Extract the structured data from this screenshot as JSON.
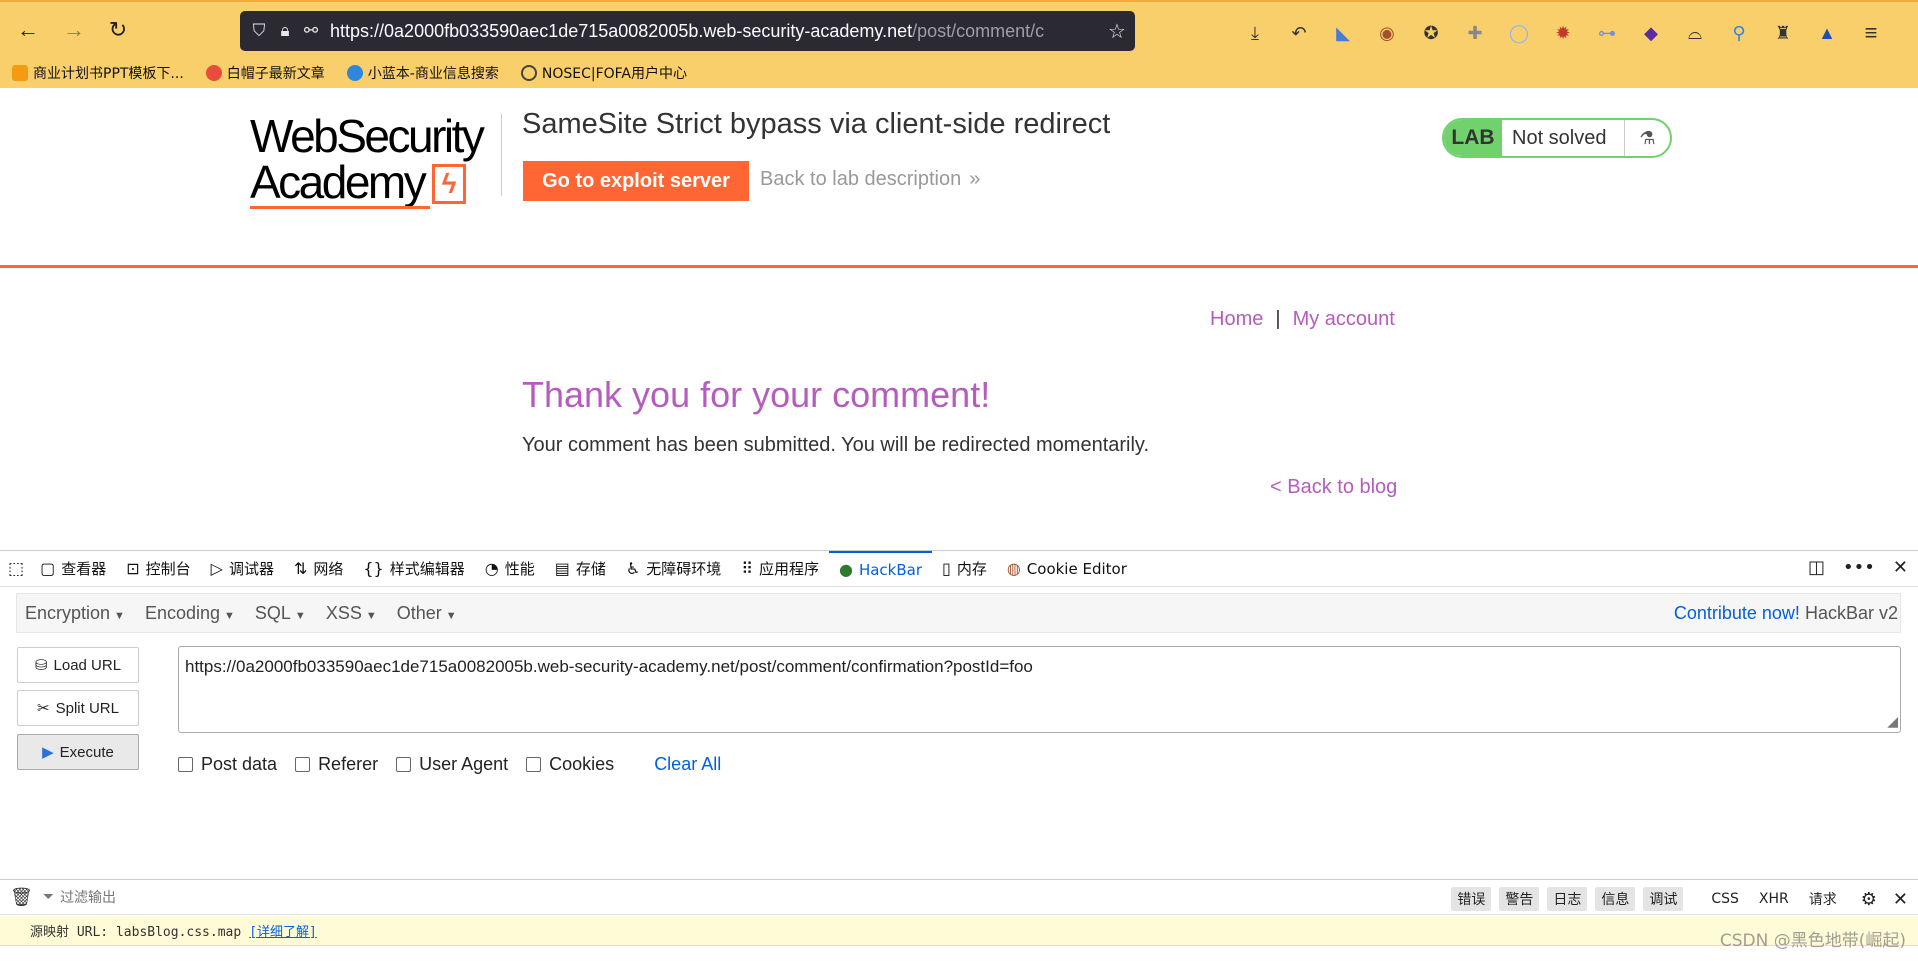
{
  "browser": {
    "url_scheme": "https://",
    "url_host": "0a2000fb033590aec1de715a0082005b.web-security-academy.net",
    "url_path": "/post/comment/c",
    "extensions": [
      "download-icon",
      "undo-icon",
      "ext-bird-icon",
      "ext-cookie-icon",
      "ext-cookie2-icon",
      "ext-puzzle-icon",
      "ext-circle-icon",
      "ext-sun-icon",
      "ext-toggle-icon",
      "ext-diamond-icon",
      "ext-hat-icon",
      "ext-pin-icon",
      "ext-spy-icon",
      "ext-triangle-icon",
      "menu-icon"
    ],
    "bookmarks": [
      {
        "label": "商业计划书PPT模板下...",
        "color": "#f39c12"
      },
      {
        "label": "白帽子最新文章",
        "color": "#e74c3c"
      },
      {
        "label": "小蓝本-商业信息搜索",
        "color": "#2e86de"
      },
      {
        "label": "NOSEC|FOFA用户中心",
        "color": "#444444"
      }
    ]
  },
  "lab": {
    "logo_line1": "WebSecurity",
    "logo_line2": "Academy",
    "logo_bolt": "ϟ",
    "title": "SameSite Strict bypass via client-side redirect",
    "exploit_button": "Go to exploit server",
    "back_description": "Back to lab description",
    "back_chevron": "»",
    "status_badge": "LAB",
    "status_text": "Not solved",
    "nav_home": "Home",
    "nav_separator": "|",
    "nav_account": "My account",
    "confirmation_title": "Thank you for your comment!",
    "confirmation_text": "Your comment has been submitted. You will be redirected momentarily.",
    "back_to_blog": "< Back to blog"
  },
  "devtools": {
    "tabs": [
      {
        "label": "查看器",
        "icon": "▢"
      },
      {
        "label": "控制台",
        "icon": "⊡"
      },
      {
        "label": "调试器",
        "icon": "▷"
      },
      {
        "label": "网络",
        "icon": "⇅"
      },
      {
        "label": "样式编辑器",
        "icon": "{}"
      },
      {
        "label": "性能",
        "icon": "◔"
      },
      {
        "label": "存储",
        "icon": "▤"
      },
      {
        "label": "无障碍环境",
        "icon": "♿"
      },
      {
        "label": "应用程序",
        "icon": "⠿"
      },
      {
        "label": "HackBar",
        "icon": "●"
      },
      {
        "label": "内存",
        "icon": "▯"
      },
      {
        "label": "Cookie Editor",
        "icon": "◍"
      }
    ],
    "active_tab": "HackBar",
    "hackbar": {
      "menus": [
        "Encryption",
        "Encoding",
        "SQL",
        "XSS",
        "Other"
      ],
      "contribute_link": "Contribute now!",
      "version": "HackBar v2",
      "load_url": "Load URL",
      "split_url": "Split URL",
      "execute": "Execute",
      "url_value": "https://0a2000fb033590aec1de715a0082005b.web-security-academy.net/post/comment/confirmation?postId=foo",
      "options": [
        "Post data",
        "Referer",
        "User Agent",
        "Cookies"
      ],
      "clear_all": "Clear All"
    },
    "console": {
      "filter_placeholder": "过滤输出",
      "filters": [
        "错误",
        "警告",
        "日志",
        "信息",
        "调试"
      ],
      "extra": [
        "CSS",
        "XHR",
        "请求"
      ],
      "message_prefix": "源映射 URL: labsBlog.css.map",
      "message_link": "[详细了解]"
    }
  },
  "watermark": "CSDN @黑色地带(崛起)"
}
